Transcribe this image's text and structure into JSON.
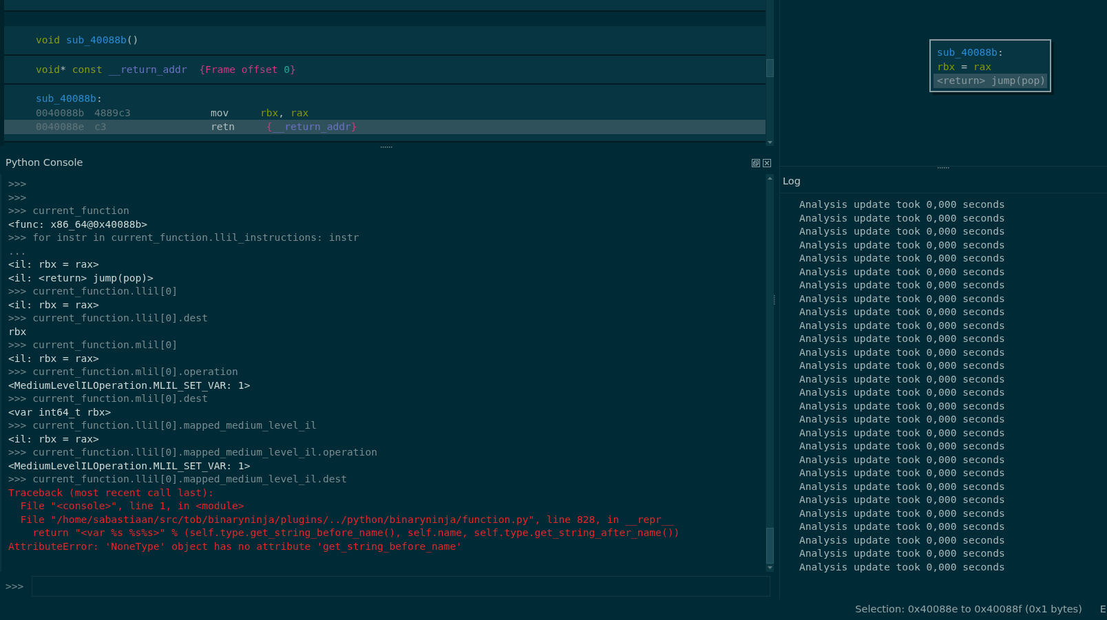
{
  "disassembly": {
    "blocks": [
      {
        "lines": [
          {
            "kind": "code",
            "tokens": [
              {
                "kind": "keyword",
                "text": "void "
              },
              {
                "kind": "function",
                "text": "sub_40088b"
              },
              {
                "kind": "plain",
                "text": "()"
              }
            ]
          }
        ]
      },
      {
        "lines": [
          {
            "kind": "code",
            "tokens": [
              {
                "kind": "keyword",
                "text": "void"
              },
              {
                "kind": "plain",
                "text": "* "
              },
              {
                "kind": "keyword",
                "text": "const "
              },
              {
                "kind": "variable",
                "text": "__return_addr"
              },
              {
                "kind": "annotation",
                "text": "  {Frame offset "
              },
              {
                "kind": "number",
                "text": "0"
              },
              {
                "kind": "annotation",
                "text": "}"
              }
            ]
          }
        ]
      },
      {
        "lines": [
          {
            "kind": "code",
            "tokens": [
              {
                "kind": "function",
                "text": "sub_40088b"
              },
              {
                "kind": "plain",
                "text": ":"
              }
            ]
          },
          {
            "kind": "instruction",
            "address": "0040088b",
            "bytes": "4889c3",
            "mnemonic": "mov",
            "selected": false,
            "operands": [
              {
                "kind": "register",
                "text": "rbx"
              },
              {
                "kind": "plain",
                "text": ", "
              },
              {
                "kind": "register",
                "text": "rax"
              }
            ]
          },
          {
            "kind": "instruction",
            "address": "0040088e",
            "bytes": "c3",
            "mnemonic": "retn",
            "selected": true,
            "operands": [
              {
                "kind": "annotation",
                "text": " {"
              },
              {
                "kind": "variable",
                "text": "__return_addr"
              },
              {
                "kind": "annotation",
                "text": "}"
              }
            ]
          }
        ]
      }
    ]
  },
  "graph_node": {
    "lines": [
      {
        "selected": false,
        "tokens": [
          {
            "kind": "function",
            "text": "sub_40088b"
          },
          {
            "kind": "plain",
            "text": ":"
          }
        ]
      },
      {
        "selected": false,
        "tokens": [
          {
            "kind": "register",
            "text": "rbx"
          },
          {
            "kind": "plain",
            "text": " = "
          },
          {
            "kind": "register",
            "text": "rax"
          }
        ]
      },
      {
        "selected": true,
        "tokens": [
          {
            "kind": "dim",
            "text": "<return> jump(pop)"
          }
        ]
      }
    ]
  },
  "console": {
    "title": "Python Console",
    "prompt": ">>>",
    "lines": [
      {
        "kind": "input",
        "text": ">>>"
      },
      {
        "kind": "input",
        "text": ">>>"
      },
      {
        "kind": "input",
        "text": ">>> current_function"
      },
      {
        "kind": "output",
        "text": "<func: x86_64@0x40088b>"
      },
      {
        "kind": "input",
        "text": ">>> for instr in current_function.llil_instructions: instr"
      },
      {
        "kind": "input",
        "text": "..."
      },
      {
        "kind": "output",
        "text": "<il: rbx = rax>"
      },
      {
        "kind": "output",
        "text": "<il: <return> jump(pop)>"
      },
      {
        "kind": "input",
        "text": ">>> current_function.llil[0]"
      },
      {
        "kind": "output",
        "text": "<il: rbx = rax>"
      },
      {
        "kind": "input",
        "text": ">>> current_function.llil[0].dest"
      },
      {
        "kind": "output",
        "text": "rbx"
      },
      {
        "kind": "input",
        "text": ">>> current_function.mlil[0]"
      },
      {
        "kind": "output",
        "text": "<il: rbx = rax>"
      },
      {
        "kind": "input",
        "text": ">>> current_function.mlil[0].operation"
      },
      {
        "kind": "output",
        "text": "<MediumLevelILOperation.MLIL_SET_VAR: 1>"
      },
      {
        "kind": "input",
        "text": ">>> current_function.mlil[0].dest"
      },
      {
        "kind": "output",
        "text": "<var int64_t rbx>"
      },
      {
        "kind": "input",
        "text": ">>> current_function.llil[0].mapped_medium_level_il"
      },
      {
        "kind": "output",
        "text": "<il: rbx = rax>"
      },
      {
        "kind": "input",
        "text": ">>> current_function.llil[0].mapped_medium_level_il.operation"
      },
      {
        "kind": "output",
        "text": "<MediumLevelILOperation.MLIL_SET_VAR: 1>"
      },
      {
        "kind": "input",
        "text": ">>> current_function.llil[0].mapped_medium_level_il.dest"
      },
      {
        "kind": "error",
        "text": "Traceback (most recent call last):"
      },
      {
        "kind": "error",
        "text": "  File \"<console>\", line 1, in <module>"
      },
      {
        "kind": "error",
        "text": "  File \"/home/sabastiaan/src/tob/binaryninja/plugins/../python/binaryninja/function.py\", line 828, in __repr__"
      },
      {
        "kind": "error",
        "text": "    return \"<var %s %s%s>\" % (self.type.get_string_before_name(), self.name, self.type.get_string_after_name())"
      },
      {
        "kind": "error",
        "text": "AttributeError: 'NoneType' object has no attribute 'get_string_before_name'"
      }
    ]
  },
  "log": {
    "title": "Log",
    "entries": [
      "Analysis update took 0,000 seconds",
      "Analysis update took 0,000 seconds",
      "Analysis update took 0,000 seconds",
      "Analysis update took 0,000 seconds",
      "Analysis update took 0,000 seconds",
      "Analysis update took 0,000 seconds",
      "Analysis update took 0,000 seconds",
      "Analysis update took 0,000 seconds",
      "Analysis update took 0,000 seconds",
      "Analysis update took 0,000 seconds",
      "Analysis update took 0,000 seconds",
      "Analysis update took 0,000 seconds",
      "Analysis update took 0,000 seconds",
      "Analysis update took 0,000 seconds",
      "Analysis update took 0,000 seconds",
      "Analysis update took 0,000 seconds",
      "Analysis update took 0,000 seconds",
      "Analysis update took 0,000 seconds",
      "Analysis update took 0,000 seconds",
      "Analysis update took 0,000 seconds",
      "Analysis update took 0,000 seconds",
      "Analysis update took 0,000 seconds",
      "Analysis update took 0,000 seconds",
      "Analysis update took 0,000 seconds",
      "Analysis update took 0,000 seconds",
      "Analysis update took 0,000 seconds",
      "Analysis update took 0,000 seconds",
      "Analysis update took 0,000 seconds"
    ]
  },
  "status_bar": {
    "selection": "Selection: 0x40088e to 0x40088f (0x1 bytes)",
    "trailing": "E"
  }
}
